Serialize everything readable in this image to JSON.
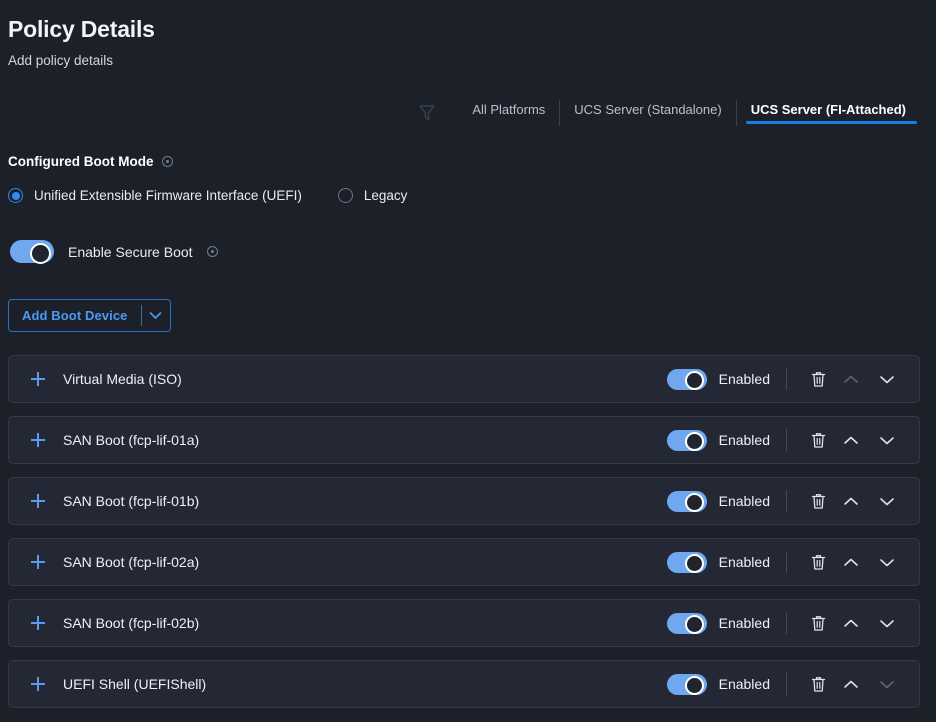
{
  "header": {
    "title": "Policy Details",
    "subtitle": "Add policy details"
  },
  "platform_tabs": {
    "filter_icon": "filter-funnel-icon",
    "items": [
      {
        "label": "All Platforms",
        "active": false
      },
      {
        "label": "UCS Server (Standalone)",
        "active": false
      },
      {
        "label": "UCS Server (FI-Attached)",
        "active": true
      }
    ]
  },
  "boot_mode": {
    "label": "Configured Boot Mode",
    "info_icon": "info-icon",
    "options": [
      {
        "label": "Unified Extensible Firmware Interface (UEFI)",
        "selected": true
      },
      {
        "label": "Legacy",
        "selected": false
      }
    ]
  },
  "secure_boot": {
    "label": "Enable Secure Boot",
    "enabled": true,
    "info_icon": "info-icon"
  },
  "add_boot_device": {
    "label": "Add Boot Device",
    "caret_icon": "chevron-down-icon"
  },
  "device_list": {
    "enabled_label": "Enabled",
    "expand_icon": "plus-icon",
    "delete_icon": "trash-icon",
    "move_up_icon": "chevron-up-icon",
    "move_down_icon": "chevron-down-icon",
    "rows": [
      {
        "name": "Virtual Media (ISO)",
        "enabled": true,
        "up_disabled": true,
        "down_disabled": false
      },
      {
        "name": "SAN Boot (fcp-lif-01a)",
        "enabled": true,
        "up_disabled": false,
        "down_disabled": false
      },
      {
        "name": "SAN Boot (fcp-lif-01b)",
        "enabled": true,
        "up_disabled": false,
        "down_disabled": false
      },
      {
        "name": "SAN Boot (fcp-lif-02a)",
        "enabled": true,
        "up_disabled": false,
        "down_disabled": false
      },
      {
        "name": "SAN Boot (fcp-lif-02b)",
        "enabled": true,
        "up_disabled": false,
        "down_disabled": false
      },
      {
        "name": "UEFI Shell (UEFIShell)",
        "enabled": true,
        "up_disabled": false,
        "down_disabled": true
      }
    ]
  },
  "colors": {
    "background": "#1c2029",
    "row_background": "#232834",
    "accent_blue": "#1b7be4",
    "link_blue": "#4a9bf5",
    "toggle_on": "#6fa8ef",
    "text_primary": "#eef1f5"
  }
}
